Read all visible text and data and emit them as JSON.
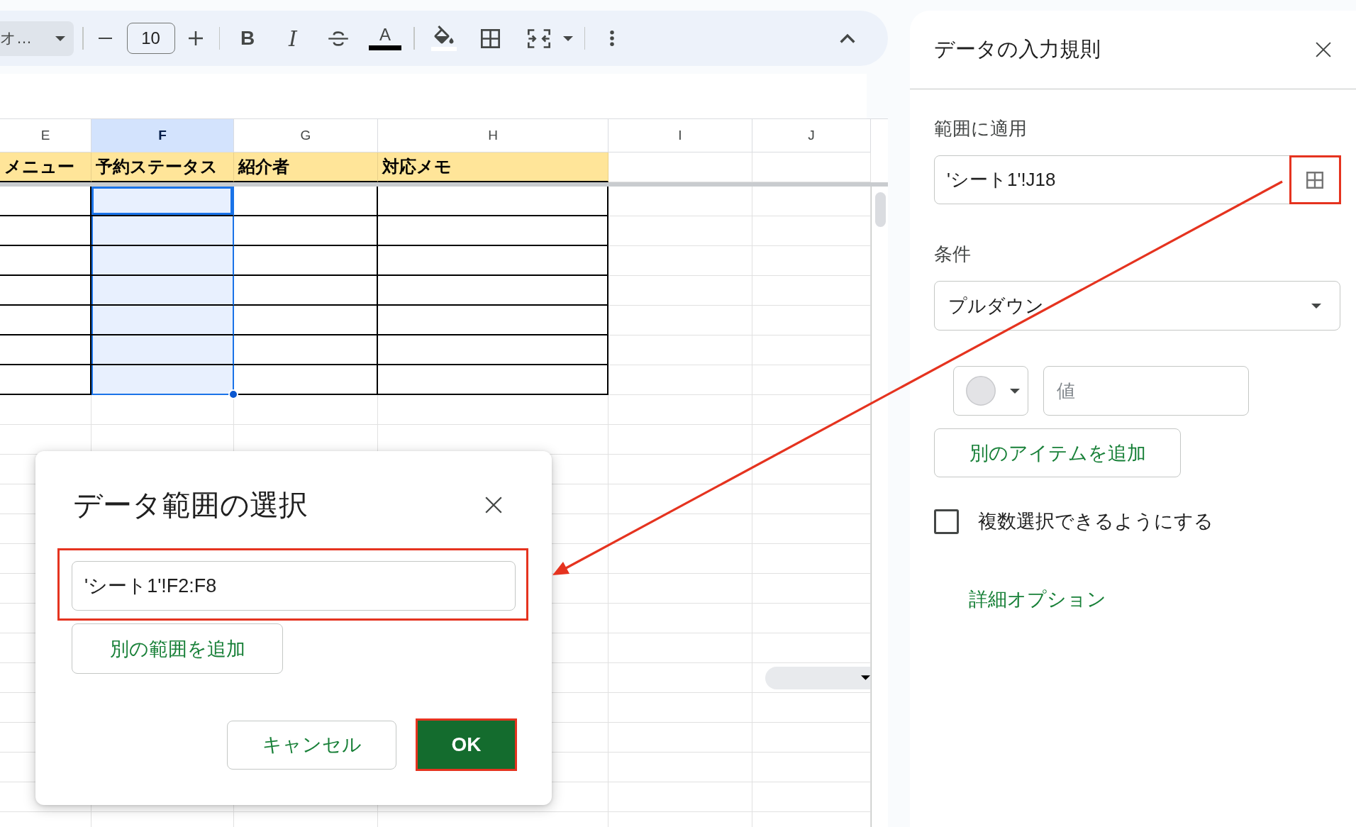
{
  "toolbar": {
    "font_menu": {
      "label": "オ…"
    },
    "font_size": {
      "value": "10"
    },
    "format_buttons": [
      {
        "kind": "bold",
        "label": "B"
      },
      {
        "kind": "italic",
        "label": "I"
      },
      {
        "kind": "strikethrough"
      },
      {
        "kind": "text_color",
        "label": "A"
      }
    ]
  },
  "sheet": {
    "columns": [
      {
        "label": "E",
        "selected": false
      },
      {
        "label": "F",
        "selected": true
      },
      {
        "label": "G",
        "selected": false
      },
      {
        "label": "H",
        "selected": false
      },
      {
        "label": "I",
        "selected": false
      },
      {
        "label": "J",
        "selected": false
      }
    ],
    "header_row": [
      "メニュー",
      "予約ステータス",
      "紹介者",
      "対応メモ"
    ]
  },
  "dialog": {
    "title": "データ範囲の選択",
    "ranges": [
      {
        "value": "'シート1'!F2:F8",
        "highlighted": true
      }
    ],
    "add_range_button": "別の範囲を追加",
    "buttons": [
      {
        "kind": "secondary",
        "label": "キャンセル",
        "highlighted": false
      },
      {
        "kind": "primary",
        "label": "OK",
        "highlighted": true
      }
    ]
  },
  "side_panel": {
    "title": "データの入力規則",
    "range_label": "範囲に適用",
    "range_field": {
      "value": "'シート1'!J18",
      "picker_highlighted": true
    },
    "criteria_label": "条件",
    "criteria_dropdown": {
      "value": "プルダウン"
    },
    "items": [
      {
        "placeholder": "値"
      }
    ],
    "add_item_button": "別のアイテムを追加",
    "multi_select": {
      "label": "複数選択できるようにする",
      "checked": false
    },
    "advanced_link": "詳細オプション"
  },
  "annotations": [
    {
      "kind": "arrow"
    }
  ]
}
